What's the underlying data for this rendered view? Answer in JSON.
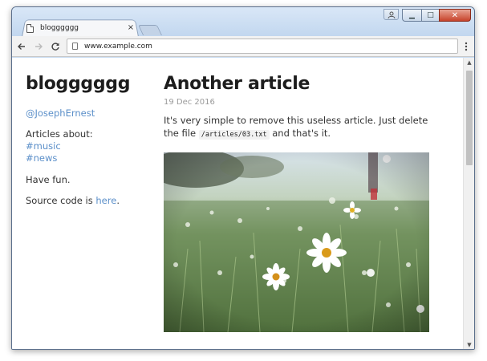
{
  "browser": {
    "tab_title": "blogggggg",
    "tab_close": "×",
    "url": "www.example.com",
    "back_icon": "arrow-left-icon",
    "forward_icon": "arrow-right-icon",
    "reload_icon": "reload-icon",
    "menu_icon": "kebab-menu-icon",
    "min_glyph": "▁",
    "max_glyph": "□",
    "close_glyph": "✕"
  },
  "sidebar": {
    "title": "blogggggg",
    "author": "@JosephErnest",
    "articles_about": "Articles about:",
    "tags": [
      "#music",
      "#news"
    ],
    "have_fun": "Have fun.",
    "source_prefix": "Source code is ",
    "source_link": "here",
    "source_suffix": "."
  },
  "article": {
    "title": "Another article",
    "date": "19 Dec 2016",
    "body_before": "It's very simple to remove this useless article. Just delete the file ",
    "code": "/articles/03.txt",
    "body_after": " and that's it."
  },
  "colors": {
    "link": "#5b8fc9",
    "text": "#333333",
    "date": "#9a9a9a"
  }
}
